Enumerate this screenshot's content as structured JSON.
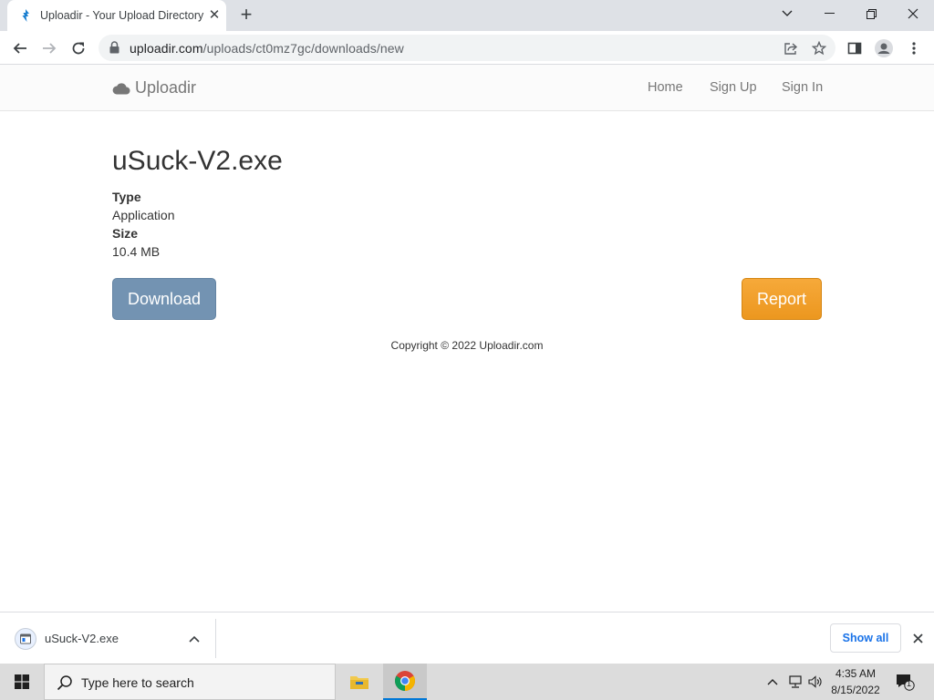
{
  "browser": {
    "tab_title": "Uploadir - Your Upload Directory",
    "url_domain": "uploadir.com",
    "url_path": "/uploads/ct0mz7gc/downloads/new"
  },
  "site": {
    "brand": "Uploadir",
    "nav": [
      "Home",
      "Sign Up",
      "Sign In"
    ]
  },
  "file": {
    "name": "uSuck-V2.exe",
    "type_label": "Type",
    "type_value": "Application",
    "size_label": "Size",
    "size_value": "10.4 MB",
    "download_label": "Download",
    "report_label": "Report"
  },
  "footer": {
    "copyright": "Copyright © 2022 Uploadir.com"
  },
  "download_shelf": {
    "file_name": "uSuck-V2.exe",
    "show_all_label": "Show all"
  },
  "taskbar": {
    "search_placeholder": "Type here to search",
    "time": "4:35 AM",
    "date": "8/15/2022",
    "notification_count": "1"
  },
  "colors": {
    "download_button": "#7393b2",
    "report_button": "#ec971f",
    "link_blue": "#1a73e8"
  }
}
